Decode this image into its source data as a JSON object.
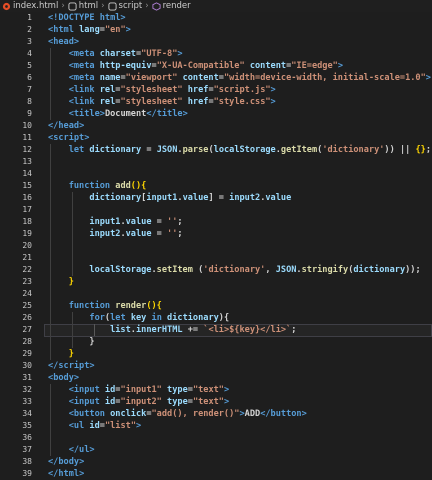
{
  "breadcrumb": {
    "file": "index.html",
    "path": [
      "html",
      "script",
      "render"
    ]
  },
  "colors": {
    "tag": "#569cd6",
    "attr": "#9cdcfe",
    "string": "#ce9178",
    "keyword": "#569cd6",
    "func": "#dcdcaa",
    "text": "#d4d4d4",
    "brace": "#ffd700"
  },
  "lines": [
    {
      "n": "1",
      "code": [
        [
          "<!DOCTYPE html>",
          "tag"
        ]
      ]
    },
    {
      "n": "2",
      "code": [
        [
          "<",
          "tag"
        ],
        [
          "html ",
          "tag"
        ],
        [
          "lang",
          "attr"
        ],
        [
          "=",
          "text"
        ],
        [
          "\"en\"",
          "string"
        ],
        [
          ">",
          "tag"
        ]
      ]
    },
    {
      "n": "3",
      "code": [
        [
          "<",
          "tag"
        ],
        [
          "head",
          "tag"
        ],
        [
          ">",
          "tag"
        ]
      ]
    },
    {
      "n": "4",
      "code": [
        [
          "    <",
          "tag"
        ],
        [
          "meta ",
          "tag"
        ],
        [
          "charset",
          "attr"
        ],
        [
          "=",
          "text"
        ],
        [
          "\"UTF-8\"",
          "string"
        ],
        [
          ">",
          "tag"
        ]
      ]
    },
    {
      "n": "5",
      "code": [
        [
          "    <",
          "tag"
        ],
        [
          "meta ",
          "tag"
        ],
        [
          "http-equiv",
          "attr"
        ],
        [
          "=",
          "text"
        ],
        [
          "\"X-UA-Compatible\"",
          "string"
        ],
        [
          " content",
          "attr"
        ],
        [
          "=",
          "text"
        ],
        [
          "\"IE=edge\"",
          "string"
        ],
        [
          ">",
          "tag"
        ]
      ]
    },
    {
      "n": "6",
      "code": [
        [
          "    <",
          "tag"
        ],
        [
          "meta ",
          "tag"
        ],
        [
          "name",
          "attr"
        ],
        [
          "=",
          "text"
        ],
        [
          "\"viewport\"",
          "string"
        ],
        [
          " content",
          "attr"
        ],
        [
          "=",
          "text"
        ],
        [
          "\"width=device-width, initial-scale=1.0\"",
          "string"
        ],
        [
          ">",
          "tag"
        ]
      ]
    },
    {
      "n": "7",
      "code": [
        [
          "    <",
          "tag"
        ],
        [
          "link ",
          "tag"
        ],
        [
          "rel",
          "attr"
        ],
        [
          "=",
          "text"
        ],
        [
          "\"stylesheet\"",
          "string"
        ],
        [
          " href",
          "attr"
        ],
        [
          "=",
          "text"
        ],
        [
          "\"script.js\"",
          "string"
        ],
        [
          ">",
          "tag"
        ]
      ]
    },
    {
      "n": "8",
      "code": [
        [
          "    <",
          "tag"
        ],
        [
          "link ",
          "tag"
        ],
        [
          "rel",
          "attr"
        ],
        [
          "=",
          "text"
        ],
        [
          "\"stylesheet\"",
          "string"
        ],
        [
          " href",
          "attr"
        ],
        [
          "=",
          "text"
        ],
        [
          "\"style.css\"",
          "string"
        ],
        [
          ">",
          "tag"
        ]
      ]
    },
    {
      "n": "9",
      "code": [
        [
          "    <",
          "tag"
        ],
        [
          "title",
          "tag"
        ],
        [
          ">",
          "tag"
        ],
        [
          "Document",
          "text"
        ],
        [
          "</",
          "tag"
        ],
        [
          "title",
          "tag"
        ],
        [
          ">",
          "tag"
        ]
      ]
    },
    {
      "n": "10",
      "code": [
        [
          "</",
          "tag"
        ],
        [
          "head",
          "tag"
        ],
        [
          ">",
          "tag"
        ]
      ]
    },
    {
      "n": "11",
      "code": [
        [
          "<",
          "tag"
        ],
        [
          "script",
          "tag"
        ],
        [
          ">",
          "tag"
        ]
      ]
    },
    {
      "n": "12",
      "code": [
        [
          "    let ",
          "keyword"
        ],
        [
          "dictionary ",
          "attr"
        ],
        [
          "= ",
          "text"
        ],
        [
          "JSON",
          "attr"
        ],
        [
          ".",
          "text"
        ],
        [
          "parse",
          "func"
        ],
        [
          "(",
          "text"
        ],
        [
          "localStorage",
          "attr"
        ],
        [
          ".",
          "text"
        ],
        [
          "getItem",
          "func"
        ],
        [
          "(",
          "text"
        ],
        [
          "'dictionary'",
          "string"
        ],
        [
          ")) || ",
          "text"
        ],
        [
          "{}",
          "brace"
        ],
        [
          ";",
          "text"
        ]
      ]
    },
    {
      "n": "13",
      "code": []
    },
    {
      "n": "14",
      "code": []
    },
    {
      "n": "15",
      "code": [
        [
          "    function ",
          "keyword"
        ],
        [
          "add",
          "func"
        ],
        [
          "(){",
          "brace"
        ]
      ]
    },
    {
      "n": "16",
      "code": [
        [
          "        dictionary",
          "attr"
        ],
        [
          "[",
          "text"
        ],
        [
          "input1",
          "attr"
        ],
        [
          ".",
          "text"
        ],
        [
          "value",
          "attr"
        ],
        [
          "] = ",
          "text"
        ],
        [
          "input2",
          "attr"
        ],
        [
          ".",
          "text"
        ],
        [
          "value",
          "attr"
        ]
      ]
    },
    {
      "n": "17",
      "code": []
    },
    {
      "n": "18",
      "code": [
        [
          "        input1",
          "attr"
        ],
        [
          ".",
          "text"
        ],
        [
          "value",
          "attr"
        ],
        [
          " = ",
          "text"
        ],
        [
          "''",
          "string"
        ],
        [
          ";",
          "text"
        ]
      ]
    },
    {
      "n": "19",
      "code": [
        [
          "        input2",
          "attr"
        ],
        [
          ".",
          "text"
        ],
        [
          "value",
          "attr"
        ],
        [
          " = ",
          "text"
        ],
        [
          "''",
          "string"
        ],
        [
          ";",
          "text"
        ]
      ]
    },
    {
      "n": "20",
      "code": []
    },
    {
      "n": "21",
      "code": []
    },
    {
      "n": "22",
      "code": [
        [
          "        localStorage",
          "attr"
        ],
        [
          ".",
          "text"
        ],
        [
          "setItem ",
          "func"
        ],
        [
          "(",
          "text"
        ],
        [
          "'dictionary'",
          "string"
        ],
        [
          ", ",
          "text"
        ],
        [
          "JSON",
          "attr"
        ],
        [
          ".",
          "text"
        ],
        [
          "stringify",
          "func"
        ],
        [
          "(",
          "text"
        ],
        [
          "dictionary",
          "attr"
        ],
        [
          "));",
          "text"
        ]
      ]
    },
    {
      "n": "23",
      "code": [
        [
          "    }",
          "brace"
        ]
      ]
    },
    {
      "n": "24",
      "code": []
    },
    {
      "n": "25",
      "code": [
        [
          "    function ",
          "keyword"
        ],
        [
          "render",
          "func"
        ],
        [
          "(){",
          "brace"
        ]
      ]
    },
    {
      "n": "26",
      "code": [
        [
          "        for",
          "keyword"
        ],
        [
          "(",
          "text"
        ],
        [
          "let ",
          "keyword"
        ],
        [
          "key ",
          "attr"
        ],
        [
          "in ",
          "keyword"
        ],
        [
          "dictionary",
          "attr"
        ],
        [
          "){",
          "text"
        ]
      ]
    },
    {
      "n": "27",
      "code": [
        [
          "            list",
          "attr"
        ],
        [
          ".",
          "text"
        ],
        [
          "innerHTML",
          "attr"
        ],
        [
          " += ",
          "text"
        ],
        [
          "`<li>${key}</li>`",
          "string"
        ],
        [
          ";",
          "text"
        ]
      ]
    },
    {
      "n": "28",
      "code": [
        [
          "        }",
          "text"
        ]
      ]
    },
    {
      "n": "29",
      "code": [
        [
          "    }",
          "brace"
        ]
      ]
    },
    {
      "n": "30",
      "code": [
        [
          "</",
          "tag"
        ],
        [
          "script",
          "tag"
        ],
        [
          ">",
          "tag"
        ]
      ]
    },
    {
      "n": "31",
      "code": [
        [
          "<",
          "tag"
        ],
        [
          "body",
          "tag"
        ],
        [
          ">",
          "tag"
        ]
      ]
    },
    {
      "n": "32",
      "code": [
        [
          "    <",
          "tag"
        ],
        [
          "input ",
          "tag"
        ],
        [
          "id",
          "attr"
        ],
        [
          "=",
          "text"
        ],
        [
          "\"input1\"",
          "string"
        ],
        [
          " type",
          "attr"
        ],
        [
          "=",
          "text"
        ],
        [
          "\"text\"",
          "string"
        ],
        [
          ">",
          "tag"
        ]
      ]
    },
    {
      "n": "33",
      "code": [
        [
          "    <",
          "tag"
        ],
        [
          "input ",
          "tag"
        ],
        [
          "id",
          "attr"
        ],
        [
          "=",
          "text"
        ],
        [
          "\"input2\"",
          "string"
        ],
        [
          " type",
          "attr"
        ],
        [
          "=",
          "text"
        ],
        [
          "\"text\"",
          "string"
        ],
        [
          ">",
          "tag"
        ]
      ]
    },
    {
      "n": "34",
      "code": [
        [
          "    <",
          "tag"
        ],
        [
          "button ",
          "tag"
        ],
        [
          "onclick",
          "attr"
        ],
        [
          "=",
          "text"
        ],
        [
          "\"add(), render()\"",
          "string"
        ],
        [
          ">",
          "tag"
        ],
        [
          "ADD",
          "text"
        ],
        [
          "</",
          "tag"
        ],
        [
          "button",
          "tag"
        ],
        [
          ">",
          "tag"
        ]
      ]
    },
    {
      "n": "35",
      "code": [
        [
          "    <",
          "tag"
        ],
        [
          "ul ",
          "tag"
        ],
        [
          "id",
          "attr"
        ],
        [
          "=",
          "text"
        ],
        [
          "\"list\"",
          "string"
        ],
        [
          ">",
          "tag"
        ]
      ]
    },
    {
      "n": "36",
      "code": []
    },
    {
      "n": "37",
      "code": [
        [
          "    </",
          "tag"
        ],
        [
          "ul",
          "tag"
        ],
        [
          ">",
          "tag"
        ]
      ]
    },
    {
      "n": "38",
      "code": [
        [
          "</",
          "tag"
        ],
        [
          "body",
          "tag"
        ],
        [
          ">",
          "tag"
        ]
      ]
    },
    {
      "n": "39",
      "code": [
        [
          "</",
          "tag"
        ],
        [
          "html",
          "tag"
        ],
        [
          ">",
          "tag"
        ]
      ]
    }
  ]
}
